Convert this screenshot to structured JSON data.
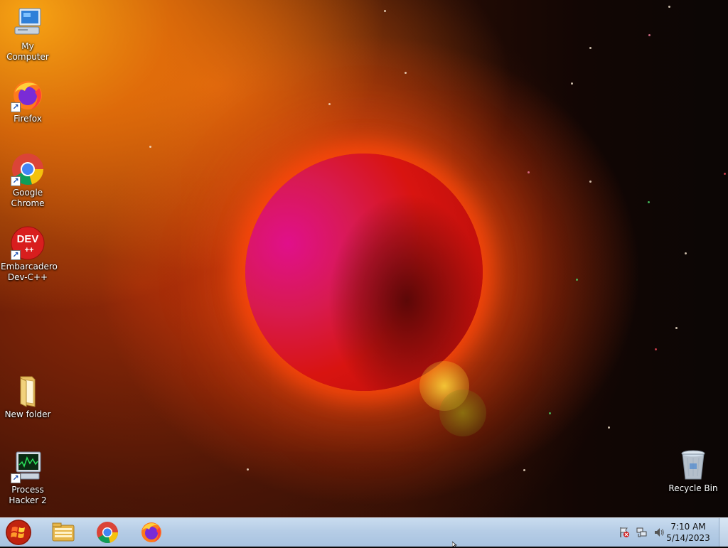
{
  "desktop": {
    "icons": [
      {
        "name": "my-computer",
        "label": "My Computer",
        "icon": "computer-icon"
      },
      {
        "name": "firefox",
        "label": "Firefox",
        "icon": "firefox-icon"
      },
      {
        "name": "google-chrome",
        "label": "Google Chrome",
        "icon": "chrome-icon"
      },
      {
        "name": "dev-cpp",
        "label": "Embarcadero Dev-C++",
        "icon": "devcpp-icon",
        "badge": "DEV"
      },
      {
        "name": "new-folder",
        "label": "New folder",
        "icon": "folder-icon"
      },
      {
        "name": "process-hacker",
        "label": "Process Hacker 2",
        "icon": "process-hacker-icon"
      },
      {
        "name": "recycle-bin",
        "label": "Recycle Bin",
        "icon": "recycle-bin-icon"
      }
    ]
  },
  "taskbar": {
    "start": {
      "icon": "windows-orb-icon"
    },
    "pinned": [
      {
        "name": "explorer",
        "icon": "folder-icon"
      },
      {
        "name": "chrome",
        "icon": "chrome-icon"
      },
      {
        "name": "firefox",
        "icon": "firefox-icon"
      }
    ],
    "tray": {
      "icons": [
        "action-center-flag-icon",
        "network-icon",
        "speaker-icon"
      ],
      "time": "7:10 AM",
      "date": "5/14/2023"
    }
  },
  "colors": {
    "taskbar_bg": "#b6cde6",
    "label_text": "#ffffff",
    "planet": "#d81410",
    "chrome_red": "#db4437",
    "chrome_yellow": "#f4c20d",
    "chrome_green": "#0f9d58",
    "chrome_blue": "#4285f4"
  }
}
